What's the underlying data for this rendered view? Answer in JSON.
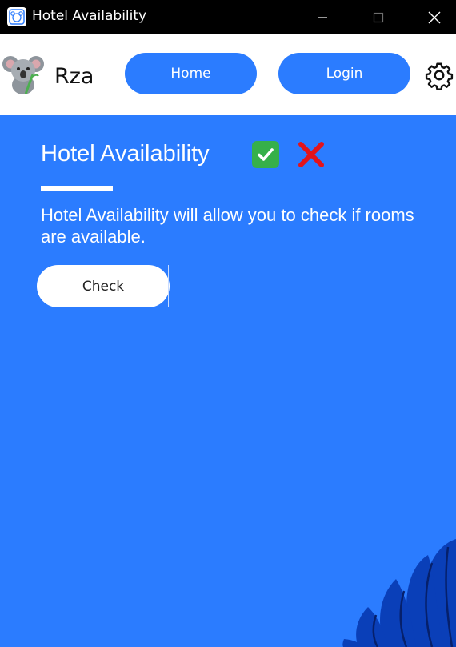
{
  "window": {
    "title": "Hotel Availability",
    "icon": "koala-app-icon",
    "controls": [
      "minimize-icon",
      "maximize-icon",
      "close-icon"
    ]
  },
  "header": {
    "logo": "koala-logo",
    "brand": "Rza",
    "nav": {
      "home_label": "Home",
      "login_label": "Login"
    },
    "settings_icon": "gear-icon"
  },
  "main": {
    "title": "Hotel Availability",
    "status_icons": [
      "check-mark-emoji",
      "cross-mark-emoji"
    ],
    "description": "Hotel Availability will allow you to check if rooms are available.",
    "check_label": "Check"
  },
  "colors": {
    "accent": "#2b7cff",
    "titlebar": "#000000",
    "header_bg": "#ffffff",
    "decor_dark": "#0a3fb8"
  }
}
